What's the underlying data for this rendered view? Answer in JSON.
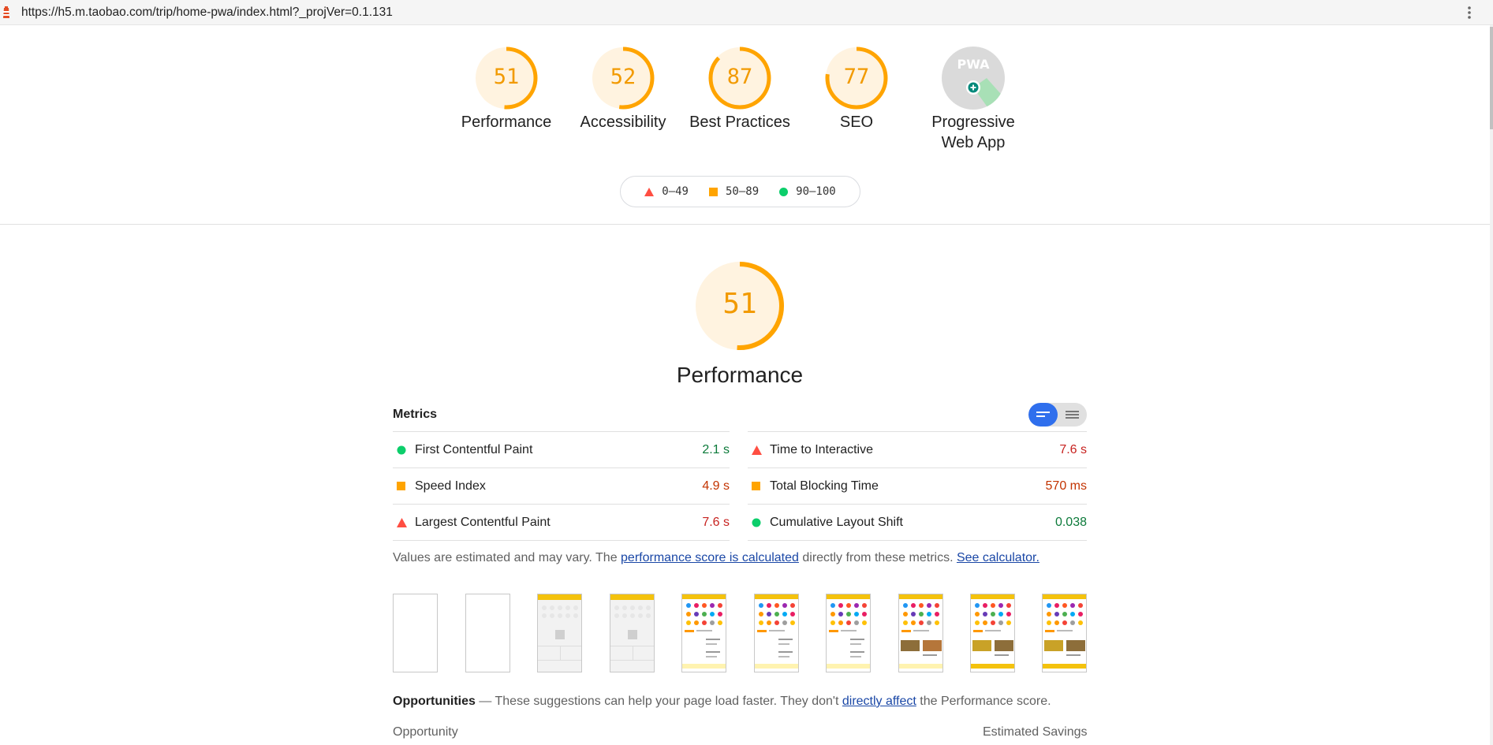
{
  "browser": {
    "url": "https://h5.m.taobao.com/trip/home-pwa/index.html?_projVer=0.1.131"
  },
  "categories": [
    {
      "label": "Performance",
      "score": "51",
      "value": 51
    },
    {
      "label": "Accessibility",
      "score": "52",
      "value": 52
    },
    {
      "label": "Best Practices",
      "score": "87",
      "value": 87
    },
    {
      "label": "SEO",
      "score": "77",
      "value": 77
    },
    {
      "label_line1": "Progressive",
      "label_line2": "Web App",
      "badge_text": "PWA"
    }
  ],
  "legend": {
    "fail": "0–49",
    "average": "50–89",
    "pass": "90–100"
  },
  "performance": {
    "score": "51",
    "value": 51,
    "title": "Performance",
    "metrics_title": "Metrics",
    "metrics": [
      {
        "name": "First Contentful Paint",
        "value": "2.1 s",
        "status": "pass"
      },
      {
        "name": "Time to Interactive",
        "value": "7.6 s",
        "status": "fail"
      },
      {
        "name": "Speed Index",
        "value": "4.9 s",
        "status": "average"
      },
      {
        "name": "Total Blocking Time",
        "value": "570 ms",
        "status": "average"
      },
      {
        "name": "Largest Contentful Paint",
        "value": "7.6 s",
        "status": "fail"
      },
      {
        "name": "Cumulative Layout Shift",
        "value": "0.038",
        "status": "pass"
      }
    ],
    "note": {
      "prefix": "Values are estimated and may vary. The ",
      "link1": "performance score is calculated",
      "middle": " directly from these metrics. ",
      "link2": "See calculator."
    },
    "opportunities": {
      "title": "Opportunities",
      "text1": " — These suggestions can help your page load faster. They don't ",
      "link": "directly affect",
      "text2": " the Performance score.",
      "col_opportunity": "Opportunity",
      "col_savings": "Estimated Savings"
    }
  },
  "colors": {
    "pass": "#0cce6b",
    "average": "#ffa400",
    "fail": "#ff4e42",
    "accent": "#2f6fed"
  }
}
